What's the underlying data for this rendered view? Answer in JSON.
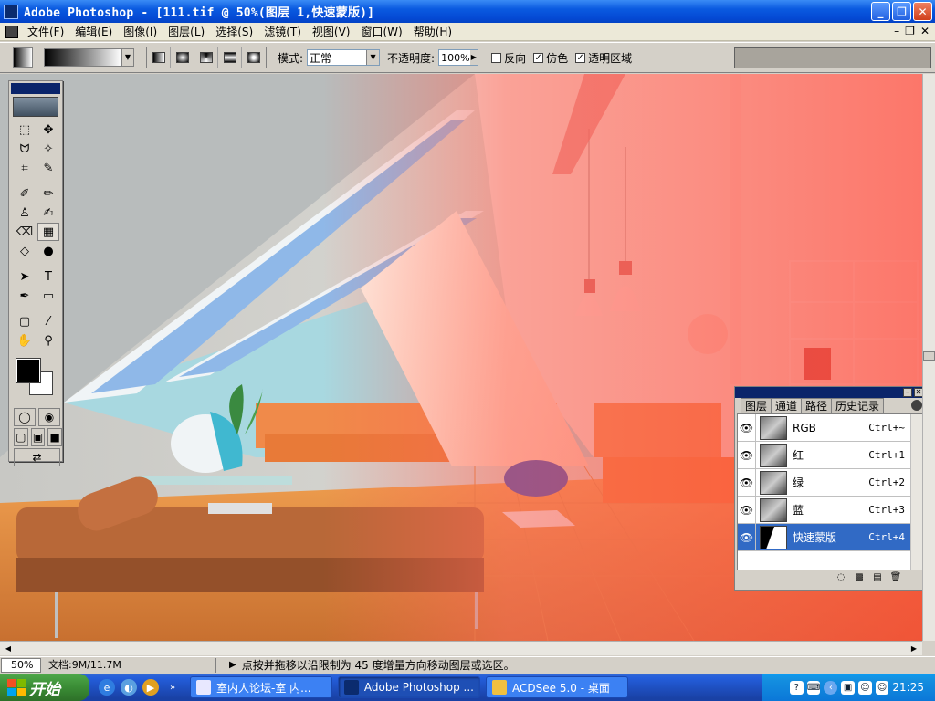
{
  "window": {
    "title": "Adobe Photoshop - [111.tif @ 50%(图层 1,快速蒙版)]",
    "minimize": "_",
    "restore": "❐",
    "close": "✕"
  },
  "menu": {
    "items": [
      "文件(F)",
      "编辑(E)",
      "图像(I)",
      "图层(L)",
      "选择(S)",
      "滤镜(T)",
      "视图(V)",
      "窗口(W)",
      "帮助(H)"
    ],
    "mdi_minimize": "–",
    "mdi_restore": "❐",
    "mdi_close": "✕"
  },
  "options": {
    "mode_label": "模式:",
    "mode_value": "正常",
    "opacity_label": "不透明度:",
    "opacity_value": "100%",
    "reverse_label": "反向",
    "reverse_checked": false,
    "dither_label": "仿色",
    "dither_checked": true,
    "transparency_label": "透明区域",
    "transparency_checked": true
  },
  "toolbox": {
    "tools": [
      {
        "name": "marquee-tool",
        "icon": "⬚"
      },
      {
        "name": "move-tool",
        "icon": "✥"
      },
      {
        "name": "lasso-tool",
        "icon": "ᗢ"
      },
      {
        "name": "magic-wand-tool",
        "icon": "✧"
      },
      {
        "name": "crop-tool",
        "icon": "⌗"
      },
      {
        "name": "slice-tool",
        "icon": "✎"
      },
      {
        "name": "healing-brush-tool",
        "icon": "✐"
      },
      {
        "name": "brush-tool",
        "icon": "✏"
      },
      {
        "name": "clone-stamp-tool",
        "icon": "♙"
      },
      {
        "name": "history-brush-tool",
        "icon": "✍"
      },
      {
        "name": "eraser-tool",
        "icon": "⌫"
      },
      {
        "name": "gradient-tool",
        "icon": "▦"
      },
      {
        "name": "blur-tool",
        "icon": "◇"
      },
      {
        "name": "dodge-tool",
        "icon": "●"
      },
      {
        "name": "path-selection-tool",
        "icon": "➤"
      },
      {
        "name": "type-tool",
        "icon": "T"
      },
      {
        "name": "pen-tool",
        "icon": "✒"
      },
      {
        "name": "rectangle-tool",
        "icon": "▭"
      },
      {
        "name": "notes-tool",
        "icon": "▢"
      },
      {
        "name": "eyedropper-tool",
        "icon": "⁄"
      },
      {
        "name": "hand-tool",
        "icon": "✋"
      },
      {
        "name": "zoom-tool",
        "icon": "⚲"
      }
    ],
    "active_tool": 11,
    "foreground_color": "#000000",
    "background_color": "#ffffff"
  },
  "panel": {
    "tabs": [
      "图层",
      "通道",
      "路径",
      "历史记录"
    ],
    "active_tab": 1,
    "channels": [
      {
        "name": "RGB",
        "shortcut": "Ctrl+~"
      },
      {
        "name": "红",
        "shortcut": "Ctrl+1"
      },
      {
        "name": "绿",
        "shortcut": "Ctrl+2"
      },
      {
        "name": "蓝",
        "shortcut": "Ctrl+3"
      },
      {
        "name": "快速蒙版",
        "shortcut": "Ctrl+4"
      }
    ],
    "active_channel": 4,
    "eye_icon": "👁"
  },
  "status": {
    "zoom": "50%",
    "doc_info": "文档:9M/11.7M",
    "hint": "点按并拖移以沿限制为 45 度增量方向移动图层或选区。"
  },
  "taskbar": {
    "start_label": "开始",
    "tasks": [
      {
        "label": "室内人论坛-室 内...",
        "icon_color": "#e8e8ff",
        "active": false
      },
      {
        "label": "Adobe Photoshop ...",
        "icon_color": "#0b2b6e",
        "active": true
      },
      {
        "label": "ACDSee 5.0 - 桌面",
        "icon_color": "#f0c040",
        "active": false
      }
    ],
    "lang": "EN",
    "clock": "21:25"
  },
  "colors": {
    "quick_mask_overlay": "#ff4a3a",
    "selection_highlight": "#316ac5"
  }
}
